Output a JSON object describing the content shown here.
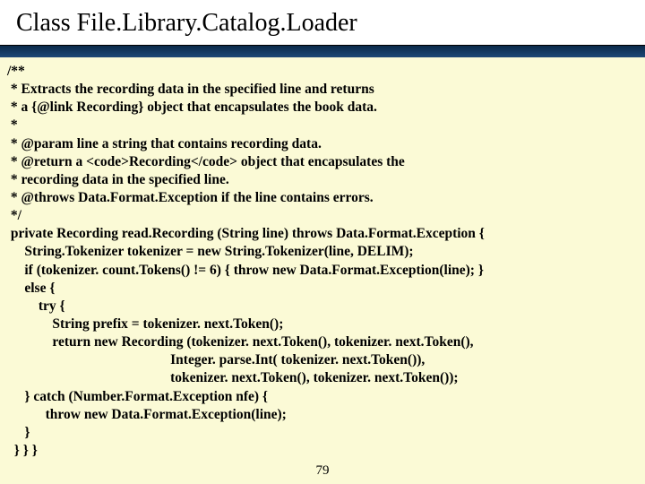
{
  "title": "Class File.Library.Catalog.Loader",
  "page_number": "79",
  "code_lines": [
    "/**",
    " * Extracts the recording data in the specified line and returns",
    " * a {@link Recording} object that encapsulates the book data.",
    " *",
    " * @param line a string that contains recording data.",
    " * @return a <code>Recording</code> object that encapsulates the",
    " * recording data in the specified line.",
    " * @throws Data.Format.Exception if the line contains errors.",
    " */",
    " private Recording read.Recording (String line) throws Data.Format.Exception {",
    "     String.Tokenizer tokenizer = new String.Tokenizer(line, DELIM);",
    "     if (tokenizer. count.Tokens() != 6) { throw new Data.Format.Exception(line); }",
    "     else {",
    "         try {",
    "             String prefix = tokenizer. next.Token();",
    "             return new Recording (tokenizer. next.Token(), tokenizer. next.Token(),",
    "                                               Integer. parse.Int( tokenizer. next.Token()),",
    "                                               tokenizer. next.Token(), tokenizer. next.Token());",
    "     } catch (Number.Format.Exception nfe) {",
    "           throw new Data.Format.Exception(line);",
    "     }",
    "  } } }"
  ]
}
